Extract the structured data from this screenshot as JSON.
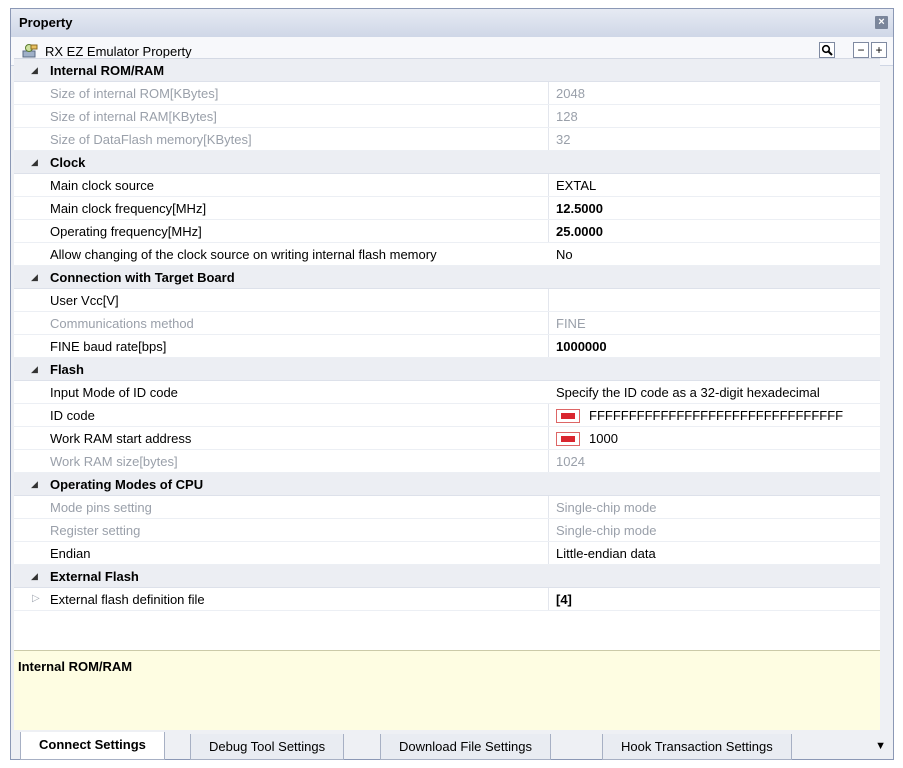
{
  "panel": {
    "title": "Property",
    "close_icon": "close-icon",
    "subheader": "RX EZ Emulator Property",
    "search_icon": "magnifier-icon",
    "collapse_label": "−",
    "expand_label": "+"
  },
  "categories": {
    "internal": "Internal ROM/RAM",
    "clock": "Clock",
    "connection": "Connection with Target Board",
    "flash": "Flash",
    "cpu": "Operating Modes of CPU",
    "extflash": "External Flash"
  },
  "props": {
    "rom_size": {
      "name": "Size of internal ROM[KBytes]",
      "value": "2048"
    },
    "ram_size": {
      "name": "Size of internal RAM[KBytes]",
      "value": "128"
    },
    "dataflash_size": {
      "name": "Size of DataFlash memory[KBytes]",
      "value": "32"
    },
    "main_clock_source": {
      "name": "Main clock source",
      "value": "EXTAL"
    },
    "main_clock_freq": {
      "name": "Main clock frequency[MHz]",
      "value": "12.5000"
    },
    "op_freq": {
      "name": "Operating frequency[MHz]",
      "value": "25.0000"
    },
    "allow_clock_change": {
      "name": "Allow changing of the clock source on writing internal flash memory",
      "value": "No"
    },
    "user_vcc": {
      "name": "User Vcc[V]",
      "value": ""
    },
    "comm_method": {
      "name": "Communications method",
      "value": "FINE"
    },
    "fine_baud": {
      "name": "FINE baud rate[bps]",
      "value": "1000000"
    },
    "id_input_mode": {
      "name": "Input Mode of ID code",
      "value": "Specify the ID code as a 32-digit hexadecimal"
    },
    "id_code": {
      "name": "ID code",
      "value": "FFFFFFFFFFFFFFFFFFFFFFFFFFFFFFFF"
    },
    "work_ram_start": {
      "name": "Work RAM start address",
      "value": "1000"
    },
    "work_ram_size": {
      "name": "Work RAM size[bytes]",
      "value": "1024"
    },
    "mode_pins": {
      "name": "Mode pins setting",
      "value": "Single-chip mode"
    },
    "register_setting": {
      "name": "Register setting",
      "value": "Single-chip mode"
    },
    "endian": {
      "name": "Endian",
      "value": "Little-endian data"
    },
    "ext_flash_file": {
      "name": "External flash definition file",
      "value": "[4]"
    }
  },
  "description": {
    "title": "Internal ROM/RAM"
  },
  "tabs": [
    {
      "label": "Connect Settings",
      "active": true
    },
    {
      "label": "Debug Tool Settings",
      "active": false
    },
    {
      "label": "Download File Settings",
      "active": false
    },
    {
      "label": "Hook Transaction Settings",
      "active": false
    }
  ],
  "colors": {
    "accent_red": "#d9262f",
    "description_bg": "#fefde2"
  }
}
